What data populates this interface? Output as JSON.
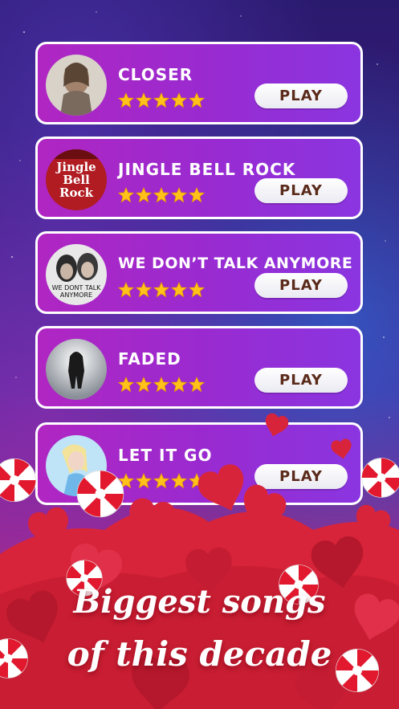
{
  "songs": [
    {
      "title": "CLOSER",
      "stars": 5,
      "play_label": "PLAY",
      "artwork_icon": "singer-portrait"
    },
    {
      "title": "JINGLE BELL ROCK",
      "stars": 5,
      "play_label": "PLAY",
      "artwork_icon": "jingle-bell-rock-logo",
      "artwork_text": [
        "Jingle",
        "Bell",
        "Rock"
      ]
    },
    {
      "title": "WE DON’T TALK ANYMORE",
      "stars": 5,
      "play_label": "PLAY",
      "artwork_icon": "duo-portrait",
      "artwork_text": "WE DONT TALK ANYMORE"
    },
    {
      "title": "FADED",
      "stars": 5,
      "play_label": "PLAY",
      "artwork_icon": "hooded-figure"
    },
    {
      "title": "LET IT GO",
      "stars": 5,
      "play_label": "PLAY",
      "artwork_icon": "ice-queen"
    }
  ],
  "promo": {
    "line1": "Biggest songs",
    "line2": "of this decade"
  },
  "colors": {
    "card": "#9a2ad0",
    "star": "#ffc21a",
    "play_text": "#5a2a1a",
    "heart": "#d8243a"
  }
}
